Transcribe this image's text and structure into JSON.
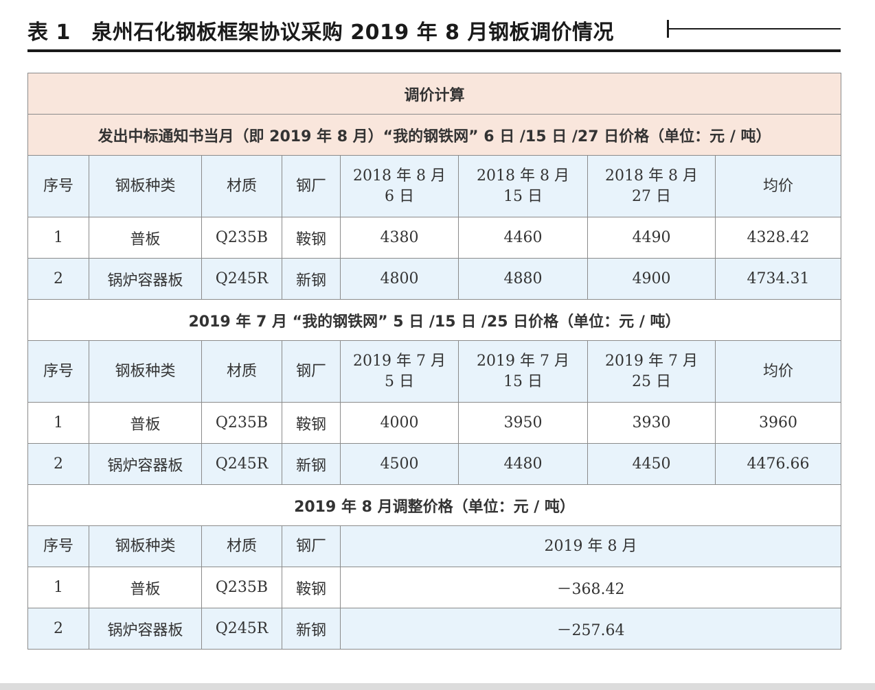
{
  "title": {
    "text": "表 1　泉州石化钢板框架协议采购 2019 年 8 月钢板调价情况"
  },
  "table": {
    "caption": "调价计算",
    "section1": {
      "title": "发出中标通知书当月（即 2019 年 8 月）“我的钢铁网” 6 日 /15 日 /27 日价格（单位：元 / 吨）",
      "headers": [
        "序号",
        "钢板种类",
        "材质",
        "钢厂",
        "2018 年 8 月\n6 日",
        "2018 年 8 月\n15 日",
        "2018 年 8 月\n27 日",
        "均价"
      ],
      "rows": [
        [
          "1",
          "普板",
          "Q235B",
          "鞍钢",
          "4380",
          "4460",
          "4490",
          "4328.42"
        ],
        [
          "2",
          "锅炉容器板",
          "Q245R",
          "新钢",
          "4800",
          "4880",
          "4900",
          "4734.31"
        ]
      ]
    },
    "section2": {
      "title": "2019 年 7 月 “我的钢铁网” 5 日 /15 日 /25 日价格（单位：元 / 吨）",
      "headers": [
        "序号",
        "钢板种类",
        "材质",
        "钢厂",
        "2019 年 7 月\n5 日",
        "2019 年 7 月\n15 日",
        "2019 年 7 月\n25 日",
        "均价"
      ],
      "rows": [
        [
          "1",
          "普板",
          "Q235B",
          "鞍钢",
          "4000",
          "3950",
          "3930",
          "3960"
        ],
        [
          "2",
          "锅炉容器板",
          "Q245R",
          "新钢",
          "4500",
          "4480",
          "4450",
          "4476.66"
        ]
      ]
    },
    "section3": {
      "title": "2019 年 8 月调整价格（单位：元 / 吨）",
      "headers": [
        "序号",
        "钢板种类",
        "材质",
        "钢厂",
        "2019 年 8 月"
      ],
      "rows": [
        [
          "1",
          "普板",
          "Q235B",
          "鞍钢",
          "－368.42"
        ],
        [
          "2",
          "锅炉容器板",
          "Q245R",
          "新钢",
          "－257.64"
        ]
      ]
    }
  },
  "colors": {
    "header_peach": "#f9e6dc",
    "header_blue": "#e8f3fb",
    "border": "#8a8a8a",
    "title_rule": "#1a1a1a"
  }
}
